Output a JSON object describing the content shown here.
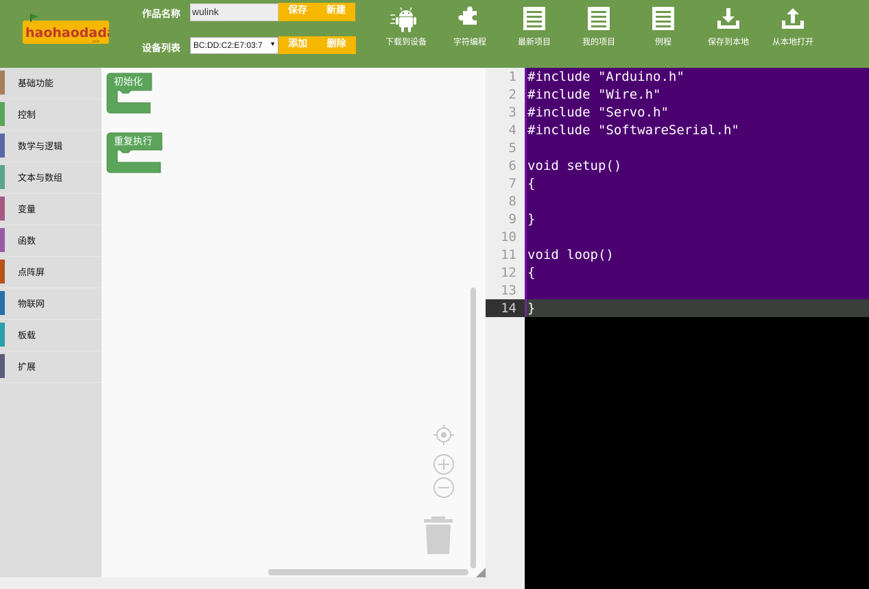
{
  "header": {
    "logo_text": "haohaodada",
    "name_label": "作品名称",
    "name_value": "wulink",
    "device_label": "设备列表",
    "device_value": "BC:DD:C2:E7:03:7",
    "save_label": "保存",
    "new_label": "新建",
    "add_label": "添加",
    "delete_label": "删除",
    "tools": [
      {
        "label": "下载到设备",
        "icon": "android-icon"
      },
      {
        "label": "字符编程",
        "icon": "puzzle-icon"
      },
      {
        "label": "最新项目",
        "icon": "list-icon"
      },
      {
        "label": "我的项目",
        "icon": "list-icon"
      },
      {
        "label": "例程",
        "icon": "list-icon"
      },
      {
        "label": "保存到本地",
        "icon": "download-icon"
      },
      {
        "label": "从本地打开",
        "icon": "upload-icon"
      }
    ],
    "colors": {
      "header_bg": "#6e9a4c",
      "button": "#f5b700"
    }
  },
  "toolbox": {
    "categories": [
      {
        "label": "基础功能",
        "color": "#a5805b"
      },
      {
        "label": "控制",
        "color": "#5ba55b"
      },
      {
        "label": "数学与逻辑",
        "color": "#5b67a5"
      },
      {
        "label": "文本与数组",
        "color": "#5ba58c"
      },
      {
        "label": "变量",
        "color": "#a55b80"
      },
      {
        "label": "函数",
        "color": "#995ba5"
      },
      {
        "label": "点阵屏",
        "color": "#b5541a"
      },
      {
        "label": "物联网",
        "color": "#2a6fa8"
      },
      {
        "label": "板载",
        "color": "#2aa0a8"
      },
      {
        "label": "扩展",
        "color": "#5b5b7a"
      }
    ]
  },
  "workspace": {
    "blocks": [
      {
        "label": "初始化",
        "color": "#5ba55b"
      },
      {
        "label": "重复执行",
        "color": "#5ba55b"
      }
    ]
  },
  "code": {
    "lines": [
      "#include \"Arduino.h\"",
      "#include \"Wire.h\"",
      "#include \"Servo.h\"",
      "#include \"SoftwareSerial.h\"",
      "",
      "void setup()",
      "{",
      "",
      "}",
      "",
      "void loop()",
      "{",
      "",
      "}"
    ],
    "active_line": 14,
    "colors": {
      "selection_bg": "#4b0070",
      "editor_bg": "#000000"
    }
  }
}
